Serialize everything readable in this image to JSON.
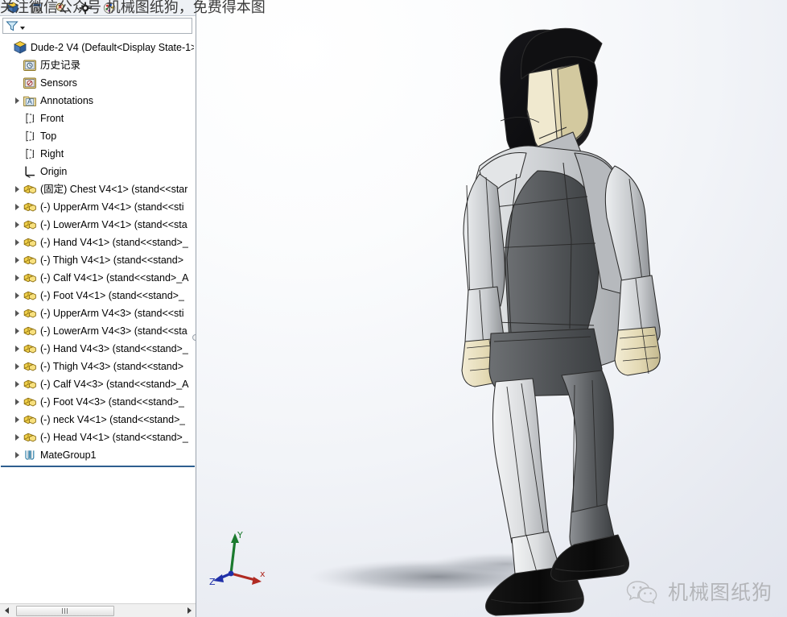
{
  "watermarks": {
    "top_text": "关注微信公众号 机械图纸狗，免费得本图",
    "bottom_right_text": "机械图纸狗",
    "bottom_right_icon": "wechat-icon"
  },
  "manager_tabs": [
    {
      "name": "feature-manager-tab",
      "icon": "feature-tree-cube-icon"
    },
    {
      "name": "property-manager-tab",
      "icon": "property-page-icon"
    },
    {
      "name": "configuration-manager-tab",
      "icon": "configuration-magnifier-icon"
    },
    {
      "name": "dimxpert-manager-tab",
      "icon": "dimxpert-crosshair-icon"
    },
    {
      "name": "display-manager-tab",
      "icon": "display-palette-icon"
    }
  ],
  "filter": {
    "icon": "filter-funnel-icon",
    "dropdown_icon": "chevron-down-icon",
    "value": "",
    "placeholder": ""
  },
  "tree": {
    "root": {
      "label": "Dude-2 V4  (Default<Display State-1>",
      "icon": "assembly-icon",
      "expandable": false
    },
    "items": [
      {
        "label": "历史记录",
        "icon": "history-icon",
        "expandable": false,
        "indent": 1
      },
      {
        "label": "Sensors",
        "icon": "sensors-icon",
        "expandable": false,
        "indent": 1
      },
      {
        "label": "Annotations",
        "icon": "annotations-icon",
        "expandable": true,
        "indent": 1
      },
      {
        "label": "Front",
        "icon": "plane-icon",
        "expandable": false,
        "indent": 1
      },
      {
        "label": "Top",
        "icon": "plane-icon",
        "expandable": false,
        "indent": 1
      },
      {
        "label": "Right",
        "icon": "plane-icon",
        "expandable": false,
        "indent": 1
      },
      {
        "label": "Origin",
        "icon": "origin-icon",
        "expandable": false,
        "indent": 1
      },
      {
        "label": "(固定) Chest V4<1>  (stand<<star",
        "icon": "component-icon",
        "expandable": true,
        "indent": 1
      },
      {
        "label": "(-) UpperArm V4<1>  (stand<<sti",
        "icon": "component-icon",
        "expandable": true,
        "indent": 1
      },
      {
        "label": "(-) LowerArm V4<1>  (stand<<sta",
        "icon": "component-icon",
        "expandable": true,
        "indent": 1
      },
      {
        "label": "(-) Hand V4<1>  (stand<<stand>_",
        "icon": "component-icon",
        "expandable": true,
        "indent": 1
      },
      {
        "label": "(-) Thigh V4<1>  (stand<<stand>",
        "icon": "component-icon",
        "expandable": true,
        "indent": 1
      },
      {
        "label": "(-) Calf V4<1>  (stand<<stand>_A",
        "icon": "component-icon",
        "expandable": true,
        "indent": 1
      },
      {
        "label": "(-) Foot V4<1>  (stand<<stand>_",
        "icon": "component-icon",
        "expandable": true,
        "indent": 1
      },
      {
        "label": "(-) UpperArm V4<3>  (stand<<sti",
        "icon": "component-icon",
        "expandable": true,
        "indent": 1
      },
      {
        "label": "(-) LowerArm V4<3>  (stand<<sta",
        "icon": "component-icon",
        "expandable": true,
        "indent": 1
      },
      {
        "label": "(-) Hand V4<3>  (stand<<stand>_",
        "icon": "component-icon",
        "expandable": true,
        "indent": 1
      },
      {
        "label": "(-) Thigh V4<3>  (stand<<stand>",
        "icon": "component-icon",
        "expandable": true,
        "indent": 1
      },
      {
        "label": "(-) Calf V4<3>  (stand<<stand>_A",
        "icon": "component-icon",
        "expandable": true,
        "indent": 1
      },
      {
        "label": "(-) Foot V4<3>  (stand<<stand>_",
        "icon": "component-icon",
        "expandable": true,
        "indent": 1
      },
      {
        "label": "(-) neck V4<1>  (stand<<stand>_",
        "icon": "component-icon",
        "expandable": true,
        "indent": 1
      },
      {
        "label": "(-) Head V4<1>  (stand<<stand>_",
        "icon": "component-icon",
        "expandable": true,
        "indent": 1
      },
      {
        "label": "MateGroup1",
        "icon": "mategroup-icon",
        "expandable": true,
        "indent": 1
      }
    ]
  },
  "scrollbar": {
    "left_arrow_icon": "arrow-left-icon",
    "right_arrow_icon": "arrow-right-icon",
    "thumb_grip_icon": "grip-icon"
  },
  "viewport": {
    "model_name": "Dude-2 V4",
    "triad": {
      "x_label": "x",
      "y_label": "Y",
      "z_label": "Z",
      "x_color": "#b02a22",
      "y_color": "#1b7a2e",
      "z_color": "#2030a8"
    },
    "colors": {
      "background_top": "#ffffff",
      "background_bottom": "#e1e5ee",
      "body_light": "#d2d5d8",
      "body_mid": "#9a9da1",
      "body_dark": "#4e5154",
      "skin": "#e6ddbd",
      "hair": "#141414",
      "shoe": "#0d0d0d",
      "edge": "#2b2b2b",
      "shadow": "#8f939a"
    }
  }
}
